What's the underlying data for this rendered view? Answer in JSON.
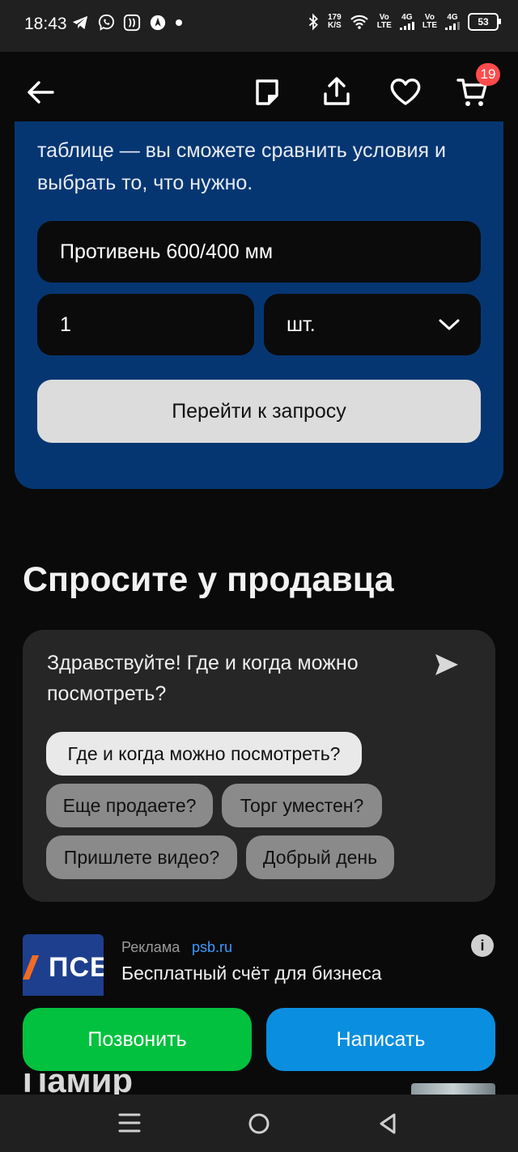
{
  "status_bar": {
    "time": "18:43",
    "net_speed_top": "179",
    "net_speed_bottom": "K/S",
    "sim1_top": "Vo",
    "sim1_bottom": "LTE",
    "sim1_gen": "4G",
    "sim2_top": "Vo",
    "sim2_bottom": "LTE",
    "sim2_gen": "4G",
    "battery": "53",
    "icons": [
      "telegram-icon",
      "viber-icon",
      "app-icon",
      "location-icon",
      "dot-icon",
      "bluetooth-icon",
      "wifi-icon",
      "signal-icon",
      "battery-icon"
    ]
  },
  "header": {
    "back_icon": "arrow-left-icon",
    "note_icon": "note-icon",
    "share_icon": "share-icon",
    "favorite_icon": "heart-icon",
    "cart_icon": "cart-icon",
    "cart_count": "19"
  },
  "request": {
    "text": "таблице — вы сможете сравнить условия и выбрать то, что нужно.",
    "item_value": "Противень 600/400 мм",
    "quantity_value": "1",
    "unit_value": "шт.",
    "submit_label": "Перейти к запросу"
  },
  "ask_seller": {
    "title": "Спросите у продавца",
    "message": "Здравствуйте! Где и когда можно посмотреть?",
    "chips": [
      "Где и когда можно посмотреть?",
      "Еще продаете?",
      "Торг уместен?",
      "Пришлете видео?",
      "Добрый день"
    ]
  },
  "ad": {
    "label": "Реклама",
    "domain": "psb.ru",
    "title": "Бесплатный счёт для бизнеса",
    "logo_text": "ПСБ"
  },
  "actions": {
    "call_label": "Позвонить",
    "write_label": "Написать"
  },
  "peek": {
    "text": "Памир"
  },
  "colors": {
    "card_blue": "#063672",
    "call_green": "#02c13e",
    "write_blue": "#0a8ee0",
    "badge_red": "#ff4b4b",
    "link_blue": "#3b9bff"
  }
}
